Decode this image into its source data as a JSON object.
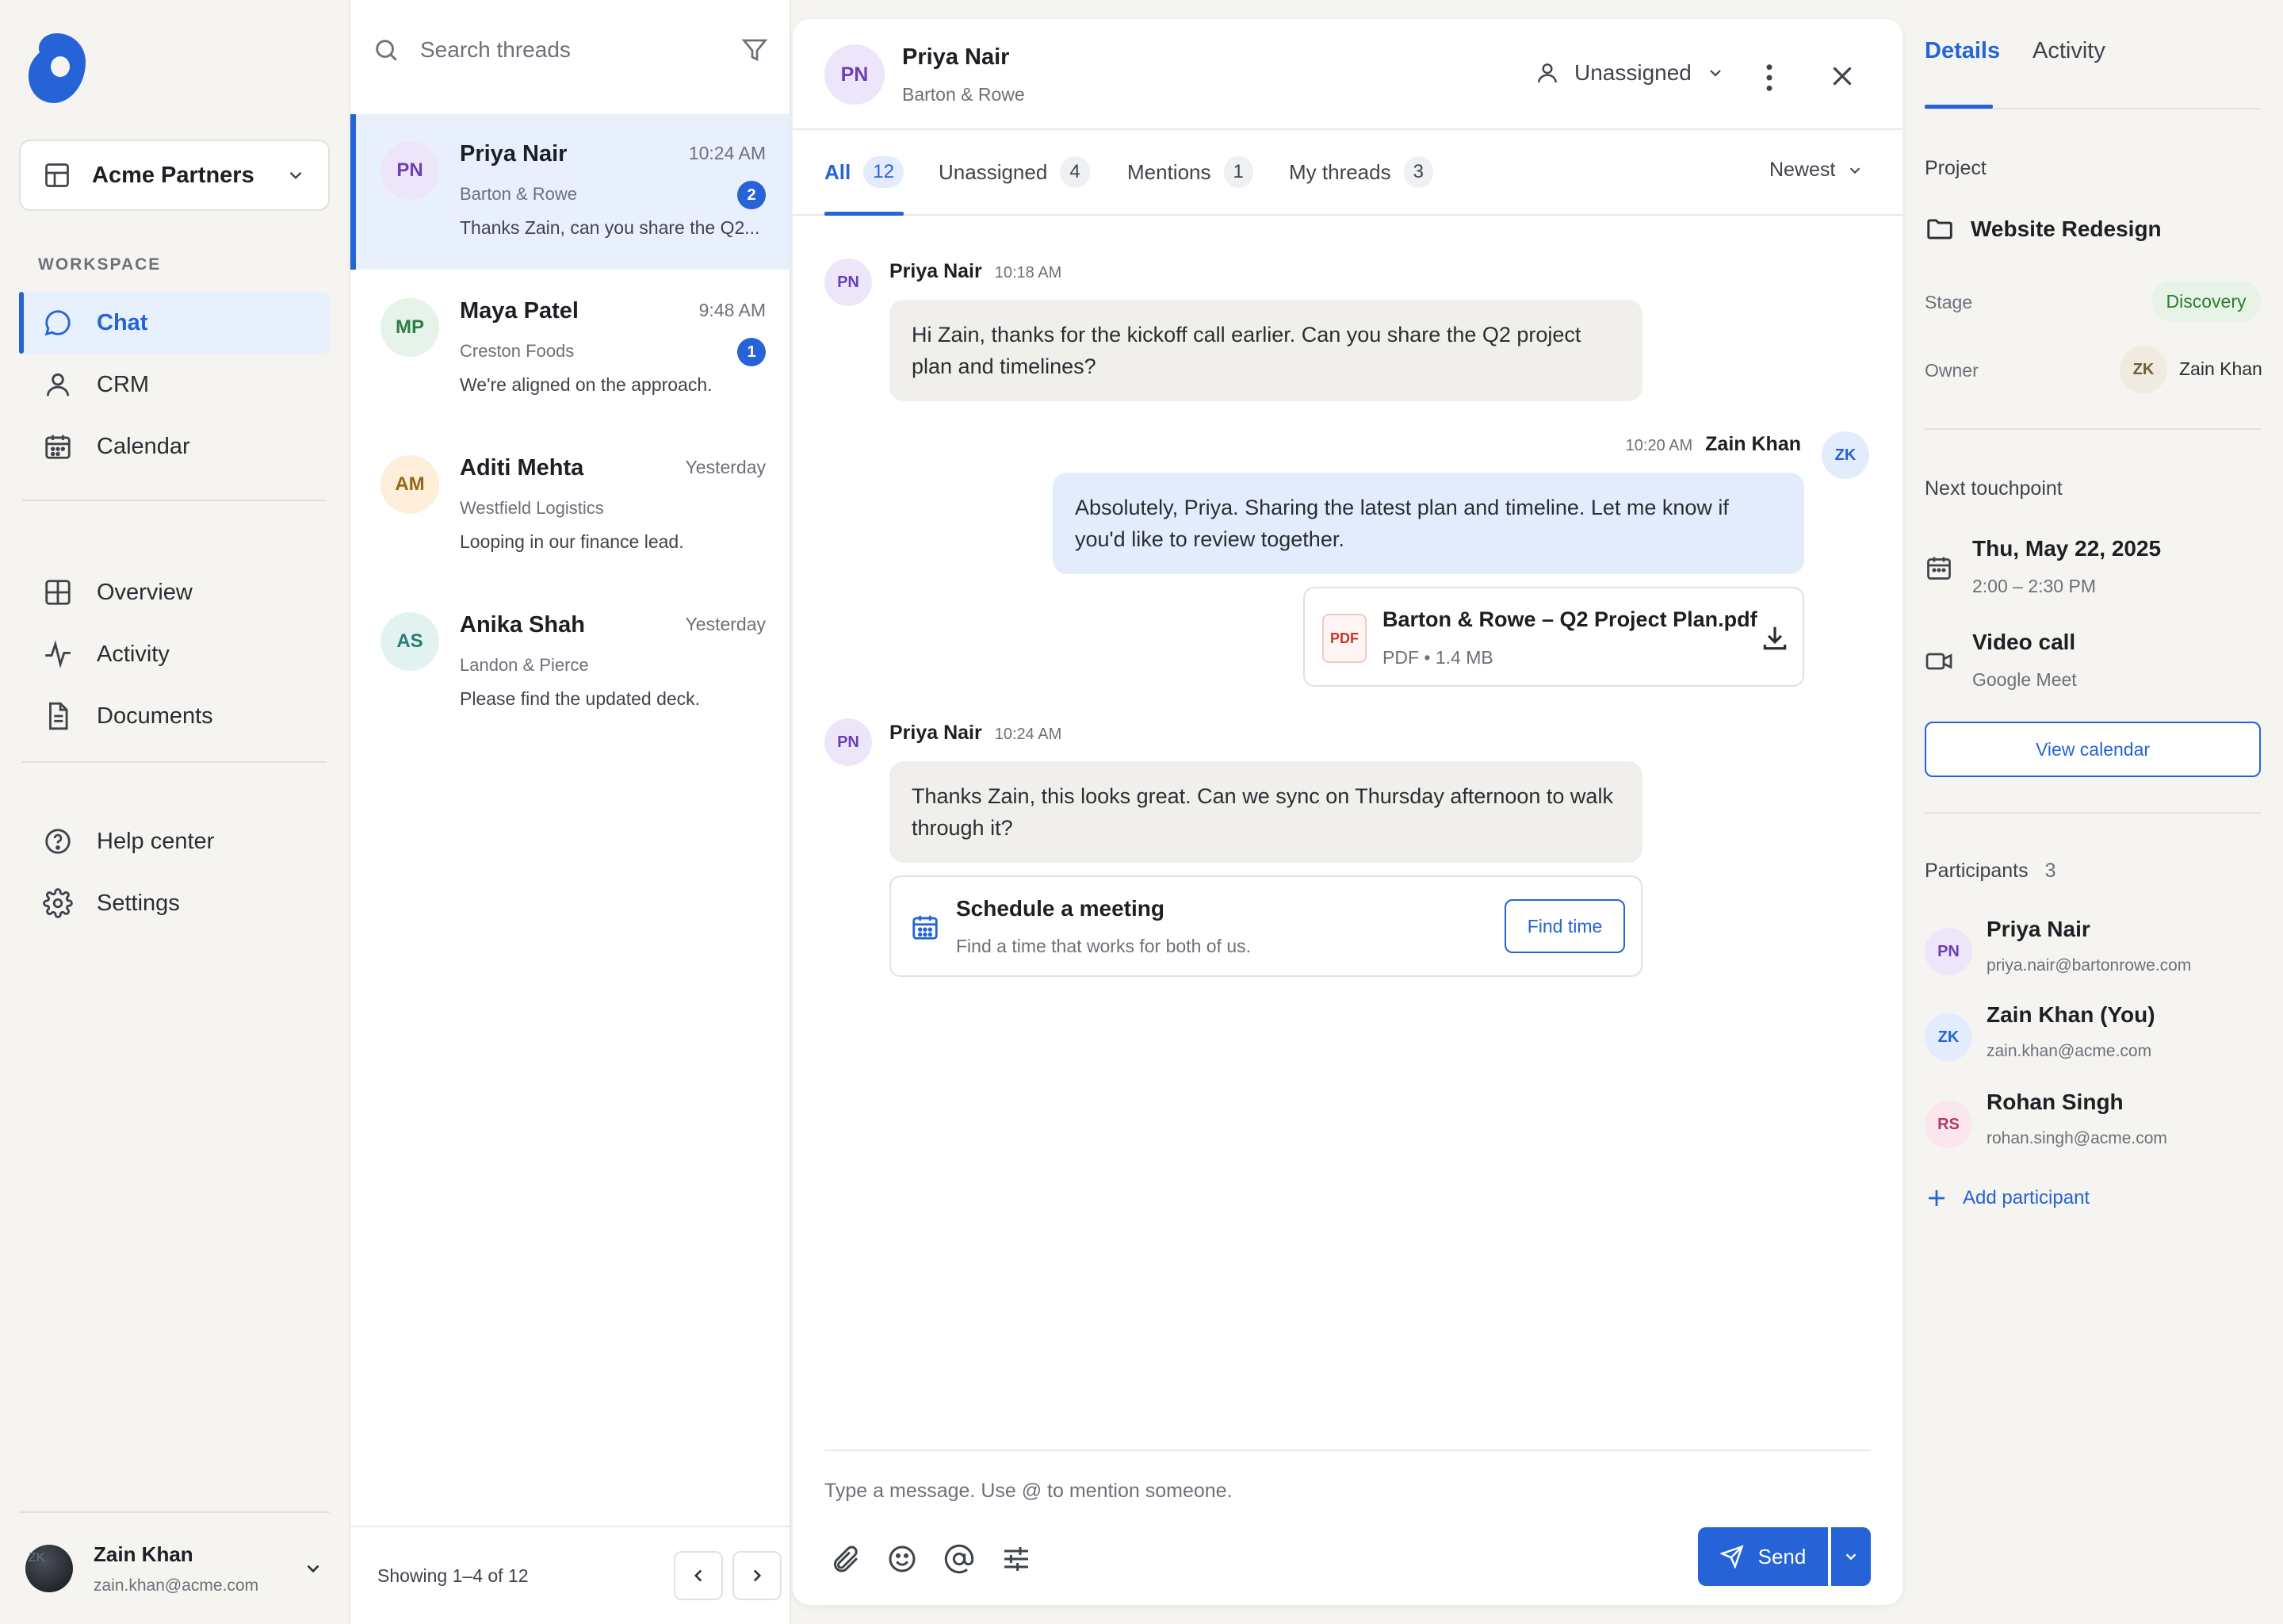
{
  "sidebar": {
    "org_name": "Acme Partners",
    "section_label": "WORKSPACE",
    "primary_nav": [
      {
        "label": "Chat",
        "icon": "chat-bubble-icon",
        "active": true
      },
      {
        "label": "CRM",
        "icon": "person-icon"
      },
      {
        "label": "Calendar",
        "icon": "calendar-icon"
      }
    ],
    "secondary_nav": [
      {
        "label": "Overview",
        "icon": "grid-icon"
      },
      {
        "label": "Activity",
        "icon": "pulse-icon"
      },
      {
        "label": "Documents",
        "icon": "document-icon"
      }
    ],
    "tertiary_nav": [
      {
        "label": "Help center",
        "icon": "help-circle-icon"
      },
      {
        "label": "Settings",
        "icon": "gear-icon"
      }
    ],
    "user": {
      "name": "Zain Khan",
      "email": "zain.khan@acme.com",
      "avatar_initials": "ZK"
    }
  },
  "threads": {
    "search_placeholder": "Search threads",
    "items": [
      {
        "initials": "PN",
        "name": "Priya Nair",
        "time": "10:24 AM",
        "org": "Barton & Rowe",
        "snippet": "Thanks Zain, can you share the Q2...",
        "unread": "2",
        "selected": true
      },
      {
        "initials": "MP",
        "name": "Maya Patel",
        "time": "9:48 AM",
        "org": "Creston Foods",
        "snippet": "We're aligned on the approach.",
        "unread": "1"
      },
      {
        "initials": "AM",
        "name": "Aditi Mehta",
        "time": "Yesterday",
        "org": "Westfield Logistics",
        "snippet": "Looping in our finance lead."
      },
      {
        "initials": "AS",
        "name": "Anika Shah",
        "time": "Yesterday",
        "org": "Landon & Pierce",
        "snippet": "Please find the updated deck."
      }
    ],
    "footer_text": "Showing 1–4 of 12"
  },
  "conversation": {
    "contact": {
      "initials": "PN",
      "name": "Priya Nair",
      "org": "Barton & Rowe"
    },
    "assignee_label": "Unassigned",
    "tabs": [
      {
        "label": "All",
        "count": "12",
        "active": true
      },
      {
        "label": "Unassigned",
        "count": "4"
      },
      {
        "label": "Mentions",
        "count": "1"
      },
      {
        "label": "My threads",
        "count": "3"
      }
    ],
    "sort_label": "Newest",
    "messages": [
      {
        "initials": "PN",
        "sender": "Priya Nair",
        "time": "10:18 AM",
        "text": "Hi Zain, thanks for the kickoff call earlier. Can you share the Q2 project plan and timelines?"
      },
      {
        "initials": "ZK",
        "sender": "Zain Khan",
        "time": "10:20 AM",
        "text": "Absolutely, Priya. Sharing the latest plan and timeline. Let me know if you'd like to review together."
      },
      {
        "initials": "PN",
        "sender": "Priya Nair",
        "time": "10:24 AM",
        "text": "Thanks Zain, this looks great. Can we sync on Thursday afternoon to walk through it?"
      }
    ],
    "attachment": {
      "badge": "PDF",
      "name": "Barton & Rowe – Q2 Project Plan.pdf",
      "meta": "PDF • 1.4 MB"
    },
    "schedule_card": {
      "title": "Schedule a meeting",
      "subtitle": "Find a time that works for both of us.",
      "button": "Find time"
    },
    "composer": {
      "placeholder": "Type a message. Use @ to mention someone.",
      "send_label": "Send"
    }
  },
  "details": {
    "tabs": [
      "Details",
      "Activity"
    ],
    "project_label": "Project",
    "project_name": "Website Redesign",
    "stage_label": "Stage",
    "stage_value": "Discovery",
    "owner_label": "Owner",
    "owner_initials": "ZK",
    "owner_name": "Zain Khan",
    "touchpoint_label": "Next touchpoint",
    "touchpoint_date": "Thu, May 22, 2025",
    "touchpoint_time": "2:00 – 2:30 PM",
    "touchpoint_type": "Video call",
    "touchpoint_platform": "Google Meet",
    "view_calendar": "View calendar",
    "participants_label": "Participants",
    "participants_count": "3",
    "participants": [
      {
        "initials": "PN",
        "name": "Priya Nair",
        "email": "priya.nair@bartonrowe.com"
      },
      {
        "initials": "ZK",
        "name": "Zain Khan (You)",
        "email": "zain.khan@acme.com"
      },
      {
        "initials": "RS",
        "name": "Rohan Singh",
        "email": "rohan.singh@acme.com"
      }
    ],
    "add_participant": "Add participant"
  },
  "colors": {
    "accent": "#2563d6",
    "stage_green": "#2e7d32",
    "bubble_incoming": "#f0efeb",
    "bubble_outgoing": "#e3ecfc"
  }
}
